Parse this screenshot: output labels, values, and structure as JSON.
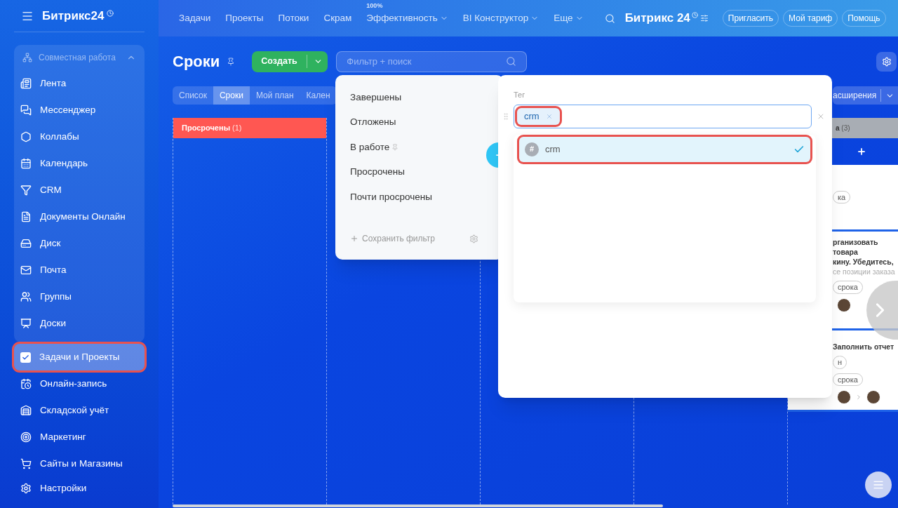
{
  "header": {
    "logo": "Битрикс24",
    "nav": [
      {
        "label": "Задачи",
        "dropdown": false
      },
      {
        "label": "Проекты",
        "dropdown": false
      },
      {
        "label": "Потоки",
        "dropdown": false
      },
      {
        "label": "Скрам",
        "dropdown": false
      },
      {
        "label": "Эффективность",
        "badge": "100%",
        "dropdown": true
      },
      {
        "label": "BI Конструктор",
        "dropdown": true
      },
      {
        "label": "Еще",
        "dropdown": true
      }
    ],
    "brand": "Битрикс 24",
    "buttons": [
      "Пригласить",
      "Мой тариф",
      "Помощь"
    ]
  },
  "sidebar": {
    "group": {
      "title": "Совместная работа",
      "expanded": true,
      "items": [
        {
          "label": "Лента",
          "selected": false
        },
        {
          "label": "Мессенджер",
          "selected": false
        },
        {
          "label": "Коллабы",
          "selected": false
        },
        {
          "label": "Календарь",
          "selected": false
        },
        {
          "label": "CRM",
          "selected": false
        },
        {
          "label": "Документы Онлайн",
          "selected": false
        },
        {
          "label": "Диск",
          "selected": false
        },
        {
          "label": "Почта",
          "selected": false
        },
        {
          "label": "Группы",
          "selected": false
        },
        {
          "label": "Доски",
          "selected": false
        }
      ]
    },
    "items": [
      {
        "label": "Задачи и Проекты",
        "selected": true,
        "highlighted": true
      },
      {
        "label": "Онлайн-запись",
        "selected": false,
        "highlighted": false
      },
      {
        "label": "Складской учёт",
        "selected": false,
        "highlighted": false
      },
      {
        "label": "Маркетинг",
        "selected": false,
        "highlighted": false
      },
      {
        "label": "Сайты и Магазины",
        "selected": false,
        "highlighted": false
      }
    ],
    "settings": "Настройки"
  },
  "page": {
    "title": "Сроки",
    "create_button": "Создать",
    "search": {
      "placeholder": "Фильтр + поиск"
    },
    "view_tabs": [
      {
        "label": "Список",
        "selected": false
      },
      {
        "label": "Сроки",
        "selected": true
      },
      {
        "label": "Мой план",
        "selected": false
      },
      {
        "label": "Кален",
        "selected": false
      }
    ],
    "extensions_button": "асширения",
    "columns": [
      {
        "title": "Просрочены",
        "count": "(1)",
        "color": "#ff5752"
      },
      {
        "title": "а",
        "count": "(3)",
        "color": "#a8adb4"
      }
    ],
    "cards": [
      {
        "tags": [
          "ка"
        ]
      },
      {
        "title_lines": [
          "рганизовать",
          "товара",
          "кину. Убедитесь,",
          "се позиции заказа"
        ],
        "tags": [
          "срока"
        ]
      },
      {
        "title_lines": [
          "Заполнить отчет"
        ],
        "tags": [
          "н",
          "срока"
        ]
      }
    ]
  },
  "filter_popup": {
    "presets": [
      {
        "label": "Завершены",
        "pinned": false
      },
      {
        "label": "Отложены",
        "pinned": false
      },
      {
        "label": "В работе",
        "pinned": true
      },
      {
        "label": "Просрочены",
        "pinned": false
      },
      {
        "label": "Почти просрочены",
        "pinned": false
      }
    ],
    "save_filter": "Сохранить фильтр",
    "field": {
      "label": "Тег",
      "tags": [
        {
          "label": "crm",
          "highlighted": true
        }
      ]
    },
    "suggestions": [
      {
        "symbol": "#",
        "label": "crm",
        "checked": true,
        "highlighted": true
      }
    ]
  }
}
